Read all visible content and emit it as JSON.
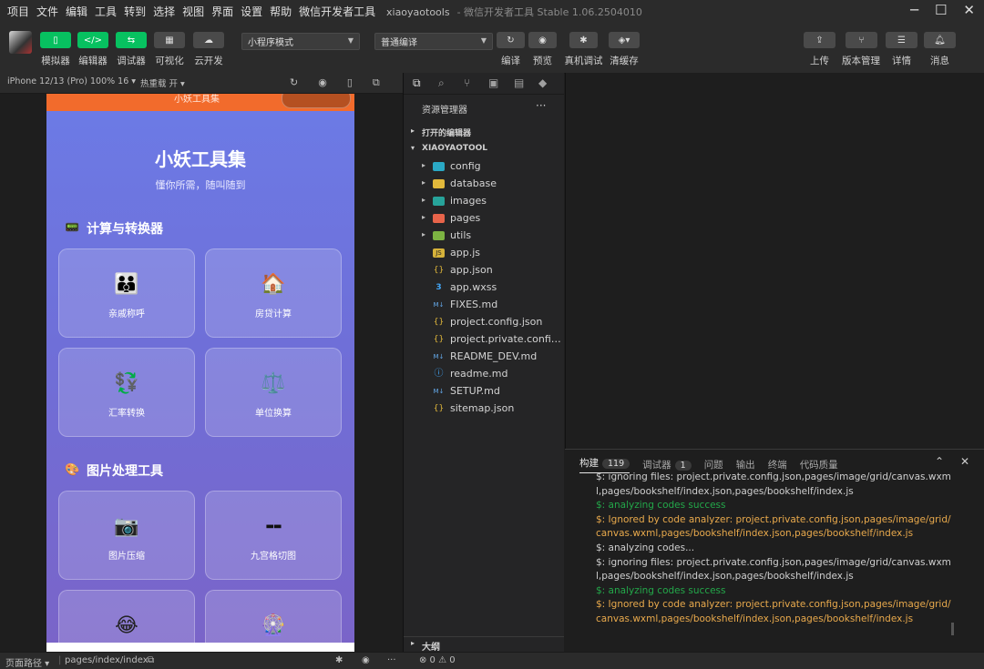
{
  "menubar": {
    "items": [
      "项目",
      "文件",
      "编辑",
      "工具",
      "转到",
      "选择",
      "视图",
      "界面",
      "设置",
      "帮助",
      "微信开发者工具"
    ],
    "title": "xiaoyaotools",
    "subtitle": "- 微信开发者工具 Stable 1.06.2504010"
  },
  "toolbar": {
    "simulator": "模拟器",
    "editor": "编辑器",
    "debugger": "调试器",
    "visual": "可视化",
    "cloud": "云开发",
    "mode_select": "小程序模式",
    "compile_select": "普通编译",
    "compile": "编译",
    "preview": "预览",
    "real_debug": "真机调试",
    "clear_cache": "清缓存",
    "upload": "上传",
    "version": "版本管理",
    "details": "详情",
    "messages": "消息"
  },
  "simulator": {
    "device": "iPhone 12/13 (Pro) 100% 16 ▾",
    "hot_reload": "热重载 开 ▾",
    "nav_title": "小妖工具集",
    "app_title": "小妖工具集",
    "app_subtitle": "懂你所需，随叫随到",
    "sections": [
      {
        "title": "计算与转换器",
        "icon": "📟"
      },
      {
        "title": "图片处理工具",
        "icon": "🎨"
      }
    ],
    "cards": [
      {
        "label": "亲戚称呼",
        "icon": "👪"
      },
      {
        "label": "房贷计算",
        "icon": "🏠"
      },
      {
        "label": "汇率转换",
        "icon": "💱"
      },
      {
        "label": "单位换算",
        "icon": "⚖️"
      },
      {
        "label": "图片压缩",
        "icon": "📷"
      },
      {
        "label": "九宫格切图",
        "icon": "▬▬"
      },
      {
        "label": "",
        "icon": "😂"
      },
      {
        "label": "",
        "icon": "🎡"
      }
    ]
  },
  "explorer": {
    "header": "资源管理器",
    "open_editors": "打开的编辑器",
    "project": "XIAOYAOTOOL",
    "folders": [
      "config",
      "database",
      "images",
      "pages",
      "utils"
    ],
    "files": [
      "app.js",
      "app.json",
      "app.wxss",
      "FIXES.md",
      "project.config.json",
      "project.private.config.js...",
      "README_DEV.md",
      "readme.md",
      "SETUP.md",
      "sitemap.json"
    ],
    "outline": "大纲"
  },
  "console": {
    "tabs": [
      {
        "label": "构建",
        "badge": "119"
      },
      {
        "label": "调试器",
        "badge": "1"
      },
      {
        "label": "问题",
        "badge": ""
      },
      {
        "label": "输出",
        "badge": ""
      },
      {
        "label": "终端",
        "badge": ""
      },
      {
        "label": "代码质量",
        "badge": ""
      }
    ],
    "lines": [
      {
        "text": "$: ignoring files: project.private.config.json,pages/image/grid/canvas.wxml,pages/bookshelf/index.json,pages/bookshelf/index.js",
        "kind": "plain"
      },
      {
        "text": "$: analyzing codes success",
        "kind": "green"
      },
      {
        "text": "$: Ignored by code analyzer: project.private.config.json,pages/image/grid/canvas.wxml,pages/bookshelf/index.json,pages/bookshelf/index.js",
        "kind": "orange"
      },
      {
        "text": "$: analyzing codes...",
        "kind": "plain"
      },
      {
        "text": "$: ignoring files: project.private.config.json,pages/image/grid/canvas.wxml,pages/bookshelf/index.json,pages/bookshelf/index.js",
        "kind": "plain"
      },
      {
        "text": "$: analyzing codes success",
        "kind": "green"
      },
      {
        "text": "$: Ignored by code analyzer: project.private.config.json,pages/image/grid/canvas.wxml,pages/bookshelf/index.json,pages/bookshelf/index.js",
        "kind": "orange"
      }
    ]
  },
  "statusbar": {
    "page_path_label": "页面路径 ▾",
    "page_path": "pages/index/index",
    "errors": "⊗ 0 ⚠ 0"
  }
}
